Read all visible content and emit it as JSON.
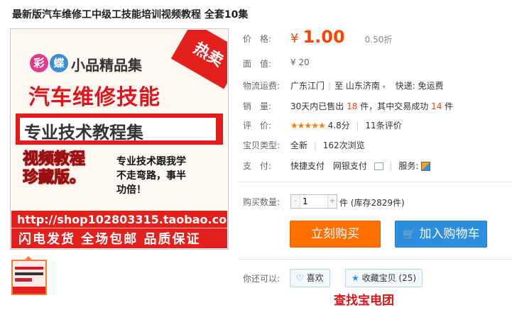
{
  "title": "最新版汽车维修工中级工技能培训视频教程 全套10集",
  "poster": {
    "badge1": "彩",
    "badge2": "蝶",
    "series": "小品精品集",
    "hot": "热卖",
    "main": "汽车维修技能",
    "sub": "专业技术教程集",
    "video_line1": "视频教程",
    "video_line2": "珍藏版。",
    "slogan1": "专业技术跟我学",
    "slogan2": "不走弯路，事半",
    "slogan3": "功倍！",
    "url": "http://shop102803315.taobao.com",
    "promises": "闪电发货 全场包邮 品质保证"
  },
  "price": {
    "label": "价　格:",
    "symbol": "¥",
    "value": "1.00",
    "discount": "0.50折"
  },
  "face_value": {
    "label": "面　值:",
    "value": "¥ 20"
  },
  "shipping": {
    "label": "物流运费:",
    "from": "广东江门",
    "to_label": "至",
    "to": "山东济南",
    "fee": "快递: 免运费"
  },
  "sales": {
    "label": "销　量:",
    "pre": "30天内已售出",
    "sold": "18",
    "mid": "件，其中交易成功",
    "success": "14",
    "unit": "件"
  },
  "rating": {
    "label": "评　价:",
    "stars": "★★★★★",
    "score": "4.8分",
    "reviews": "11条评价"
  },
  "type": {
    "label": "宝贝类型:",
    "condition": "全新",
    "views": "162次浏览"
  },
  "payment": {
    "label": "支　付:",
    "method1": "快捷支付",
    "method2": "网银支付",
    "service_label": "服务:"
  },
  "purchase": {
    "label": "购买数量:",
    "minus": "-",
    "quantity": "1",
    "plus": "+",
    "stock": "件 (库存2829件)"
  },
  "buttons": {
    "buy": "立刻购买",
    "cart": "加入购物车"
  },
  "extras": {
    "label": "你还可以:",
    "like": "喜欢",
    "favorite": "收藏宝贝 (25)",
    "peek": "查找宝电团"
  },
  "colors": {
    "price": "#ff4400",
    "buy": "#ff7000",
    "cart": "#2c8fde",
    "poster_red": "#e4201d"
  }
}
